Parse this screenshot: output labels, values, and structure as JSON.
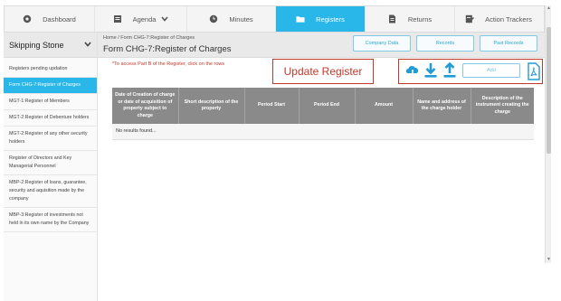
{
  "nav": {
    "items": [
      {
        "label": "Dashboard",
        "icon": "dashboard-icon"
      },
      {
        "label": "Agenda",
        "icon": "agenda-icon"
      },
      {
        "label": "Minutes",
        "icon": "clock-icon"
      },
      {
        "label": "Registers",
        "icon": "folder-icon"
      },
      {
        "label": "Returns",
        "icon": "document-icon"
      },
      {
        "label": "Action Trackers",
        "icon": "edit-checklist-icon"
      }
    ],
    "active": "Registers",
    "accent": "#29b6e8"
  },
  "sidebar": {
    "company": "Skipping Stone",
    "items": [
      "Registers pending updation",
      "Form CHG-7:Register of Charges",
      "MGT-1:Register of Members",
      "MGT-2:Register of Debenture holders",
      "MGT-2:Register of any other security holders",
      "Register of Directors and Key Managerial Personnel",
      "MBP-2:Register of loans, guarantee, security and aquisition made by the company",
      "MBP-3:Register of investments not held in its own name by the Company"
    ]
  },
  "header": {
    "breadcrumb": "Home  /  Form CHG-7:Register of Charges",
    "title": "Form CHG-7:Register of Charges",
    "buttons": [
      "Company Data",
      "Records",
      "Past Records"
    ]
  },
  "note": "*To access Part B of the Register, click on the rows",
  "annotation": "Update Register",
  "actions": {
    "icons": [
      "cloud-download-icon",
      "download-icon",
      "upload-icon",
      "pdf-icon"
    ],
    "add_label": "Add"
  },
  "table": {
    "columns": [
      "Date of Creation of charge or date of acquisition of property subject to charge",
      "Short description of the property",
      "Period Start",
      "Period End",
      "Amount",
      "Name and address of the charge holder",
      "Description of the instrument creating the charge"
    ],
    "empty_text": "No results found..."
  }
}
